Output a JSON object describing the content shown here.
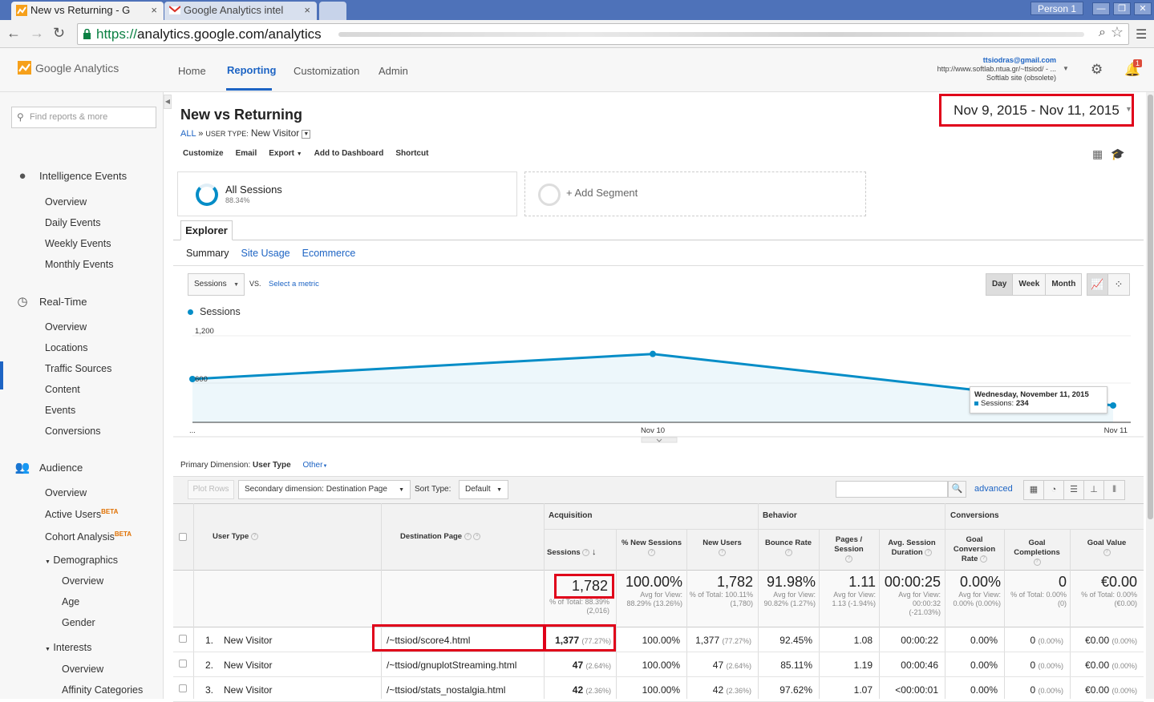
{
  "browser": {
    "tabs": [
      {
        "title": "New vs Returning - G"
      },
      {
        "title": "Google Analytics intel"
      }
    ],
    "profile": "Person 1",
    "url_scheme": "https://",
    "url_host": "analytics.google.com/analytics"
  },
  "header": {
    "logo_text": "Google Analytics",
    "nav": [
      "Home",
      "Reporting",
      "Customization",
      "Admin"
    ],
    "account_email": "ttsiodras@gmail.com",
    "account_url": "http://www.softlab.ntua.gr/~ttsiod/ - ...",
    "account_view": "Softlab site (obsolete)",
    "notification_count": "1"
  },
  "sidebar": {
    "search_placeholder": "Find reports & more",
    "sections": [
      {
        "label": "Intelligence Events",
        "items": [
          "Overview",
          "Daily Events",
          "Weekly Events",
          "Monthly Events"
        ]
      },
      {
        "label": "Real-Time",
        "items": [
          "Overview",
          "Locations",
          "Traffic Sources",
          "Content",
          "Events",
          "Conversions"
        ]
      },
      {
        "label": "Audience",
        "items": [
          "Overview",
          "Active Users",
          "Cohort Analysis"
        ],
        "beta": "BETA",
        "demographics": "Demographics",
        "demographics_items": [
          "Overview",
          "Age",
          "Gender"
        ],
        "interests": "Interests",
        "interests_items": [
          "Overview",
          "Affinity Categories"
        ]
      }
    ]
  },
  "report": {
    "title": "New vs Returning",
    "breadcrumb_all": "ALL",
    "breadcrumb_sep": "»",
    "breadcrumb_dim": "USER TYPE:",
    "breadcrumb_val": "New Visitor",
    "date_range": "Nov 9, 2015 - Nov 11, 2015",
    "actions": [
      "Customize",
      "Email",
      "Export",
      "Add to Dashboard",
      "Shortcut"
    ],
    "segment_name": "All Sessions",
    "segment_pct": "88.34%",
    "add_segment": "+ Add Segment",
    "explorer_tab": "Explorer",
    "subtabs": [
      "Summary",
      "Site Usage",
      "Ecommerce"
    ],
    "metric_select": "Sessions",
    "vs": "VS.",
    "select_metric": "Select a metric",
    "granularity": [
      "Day",
      "Week",
      "Month"
    ],
    "legend": "Sessions"
  },
  "chart_data": {
    "type": "line",
    "x": [
      "Nov 9, 2015",
      "Nov 10, 2015",
      "Nov 11, 2015"
    ],
    "series": [
      {
        "name": "Sessions",
        "values": [
          600,
          948,
          234
        ]
      }
    ],
    "x_tick_labels": [
      "...",
      "Nov 10",
      "Nov 11"
    ],
    "y_tick_labels": [
      "1,200",
      "600"
    ],
    "ylim": [
      0,
      1200
    ],
    "color": "#058dc7",
    "tooltip": {
      "date": "Wednesday, November 11, 2015",
      "label": "Sessions:",
      "value": "234"
    }
  },
  "table_controls": {
    "primary_label": "Primary Dimension:",
    "primary_value": "User Type",
    "other": "Other",
    "plot_rows": "Plot Rows",
    "secondary_dim": "Secondary dimension: Destination Page",
    "sort_label": "Sort Type:",
    "sort_value": "Default",
    "advanced": "advanced"
  },
  "table": {
    "groups": [
      "Acquisition",
      "Behavior",
      "Conversions"
    ],
    "dim_headers": [
      "User Type",
      "Destination Page"
    ],
    "columns": [
      "Sessions",
      "% New Sessions",
      "New Users",
      "Bounce Rate",
      "Pages / Session",
      "Avg. Session Duration",
      "Goal Conversion Rate",
      "Goal Completions",
      "Goal Value"
    ],
    "totals": [
      {
        "value": "1,782",
        "sub": "% of Total: 88.39% (2,016)"
      },
      {
        "value": "100.00%",
        "sub": "Avg for View: 88.29% (13.26%)"
      },
      {
        "value": "1,782",
        "sub": "% of Total: 100.11% (1,780)"
      },
      {
        "value": "91.98%",
        "sub": "Avg for View: 90.82% (1.27%)"
      },
      {
        "value": "1.11",
        "sub": "Avg for View: 1.13 (-1.94%)"
      },
      {
        "value": "00:00:25",
        "sub": "Avg for View: 00:00:32 (-21.03%)"
      },
      {
        "value": "0.00%",
        "sub": "Avg for View: 0.00% (0.00%)"
      },
      {
        "value": "0",
        "sub": "% of Total: 0.00% (0)"
      },
      {
        "value": "€0.00",
        "sub": "% of Total: 0.00% (€0.00)"
      }
    ],
    "rows": [
      {
        "idx": "1.",
        "type": "New Visitor",
        "page": "/~ttsiod/score4.html",
        "sessions": "1,377",
        "sessions_pct": "(77.27%)",
        "new_pct": "100.00%",
        "new_users": "1,377",
        "new_users_pct": "(77.27%)",
        "bounce": "92.45%",
        "pps": "1.08",
        "dur": "00:00:22",
        "gcr": "0.00%",
        "gc": "0",
        "gc_pct": "(0.00%)",
        "gv": "€0.00",
        "gv_pct": "(0.00%)"
      },
      {
        "idx": "2.",
        "type": "New Visitor",
        "page": "/~ttsiod/gnuplotStreaming.html",
        "sessions": "47",
        "sessions_pct": "(2.64%)",
        "new_pct": "100.00%",
        "new_users": "47",
        "new_users_pct": "(2.64%)",
        "bounce": "85.11%",
        "pps": "1.19",
        "dur": "00:00:46",
        "gcr": "0.00%",
        "gc": "0",
        "gc_pct": "(0.00%)",
        "gv": "€0.00",
        "gv_pct": "(0.00%)"
      },
      {
        "idx": "3.",
        "type": "New Visitor",
        "page": "/~ttsiod/stats_nostalgia.html",
        "sessions": "42",
        "sessions_pct": "(2.36%)",
        "new_pct": "100.00%",
        "new_users": "42",
        "new_users_pct": "(2.36%)",
        "bounce": "97.62%",
        "pps": "1.07",
        "dur": "<00:00:01",
        "gcr": "0.00%",
        "gc": "0",
        "gc_pct": "(0.00%)",
        "gv": "€0.00",
        "gv_pct": "(0.00%)"
      }
    ]
  }
}
